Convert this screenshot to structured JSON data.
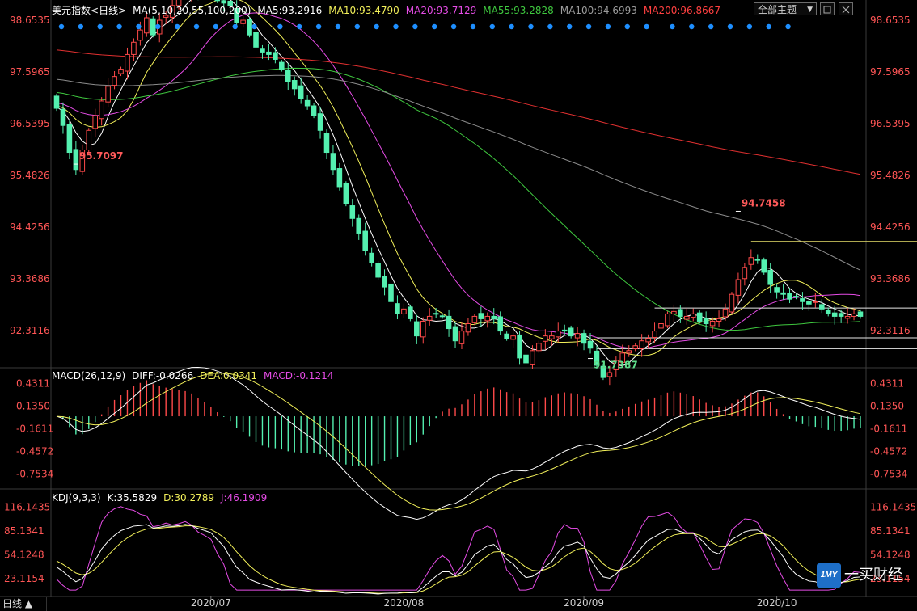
{
  "main_header": {
    "title": "美元指数",
    "period": "<日线>",
    "ma_label": "MA(5,10,20,55,100,200)",
    "ma5": "MA5:93.2916",
    "ma10": "MA10:93.4790",
    "ma20": "MA20:93.7129",
    "ma55": "MA55:93.2828",
    "ma100": "MA100:94.6993",
    "ma200": "MA200:96.8667"
  },
  "theme_button": "全部主题",
  "macd_header": {
    "label": "MACD(26,12,9)",
    "diff": "DIFF:-0.0266",
    "dea": "DEA:0.0341",
    "macd": "MACD:-0.1214"
  },
  "kdj_header": {
    "label": "KDJ(9,3,3)",
    "k": "K:35.5829",
    "d": "D:30.2789",
    "j": "J:46.1909"
  },
  "period_tab": "日线 ▲",
  "logo": {
    "badge": "1MY",
    "text": "一买财经"
  },
  "colors": {
    "up": "#ff4a4a",
    "down": "#54f0b0",
    "ma5": "#ffffff",
    "ma10": "#f2f05a",
    "ma20": "#e64ce6",
    "ma55": "#3fc83f",
    "ma100": "#8c8c8c",
    "ma200": "#e03030",
    "axis_label": "#ff5555",
    "dots": "#1e8fff"
  },
  "chart_data": [
    {
      "type": "candlestick",
      "name": "price",
      "y_ticks": [
        "98.6535",
        "97.5965",
        "96.5395",
        "95.4826",
        "94.4256",
        "93.3686",
        "92.3116"
      ],
      "ylim": [
        91.55,
        98.7
      ],
      "x_ticks": [
        "2020/07",
        "2020/08",
        "2020/09",
        "2020/10"
      ],
      "x_tick_index": [
        24,
        54,
        82,
        112
      ],
      "annotations": [
        {
          "text": "95.7097",
          "index": 3
        },
        {
          "text": "94.7458",
          "index": 106
        },
        {
          "text": "91.7387",
          "index": 83
        }
      ],
      "horizontal_lines": [
        {
          "value": 94.13,
          "from": 108,
          "to": 135
        },
        {
          "value": 92.77,
          "from": 93,
          "to": 135
        },
        {
          "value": 92.16,
          "from": 84,
          "to": 135
        },
        {
          "value": 91.94,
          "from": 84,
          "to": 135
        }
      ],
      "dots_count": 38,
      "close_start": 96.85,
      "moves": [
        -0.35,
        -0.55,
        -0.35,
        0.4,
        0.4,
        0.3,
        0.3,
        0.3,
        0.2,
        0.15,
        0.3,
        0.25,
        0.25,
        0.25,
        -0.35,
        0.3,
        0.1,
        0.2,
        0.2,
        0.1,
        0.05,
        -0.1,
        0.0,
        -0.05,
        -0.1,
        -0.05,
        -0.05,
        -0.35,
        0.05,
        -0.3,
        -0.25,
        -0.1,
        -0.05,
        -0.1,
        -0.2,
        -0.25,
        -0.15,
        -0.2,
        -0.15,
        -0.2,
        -0.3,
        -0.45,
        -0.35,
        -0.35,
        -0.35,
        -0.3,
        -0.3,
        -0.35,
        -0.25,
        -0.3,
        -0.2,
        -0.3,
        -0.25,
        0.1,
        -0.2,
        -0.35,
        0.3,
        0.1,
        0.05,
        -0.05,
        -0.25,
        -0.25,
        0.2,
        0.15,
        0.15,
        -0.05,
        0.05,
        -0.05,
        -0.25,
        -0.15,
        0.05,
        -0.45,
        -0.1,
        0.25,
        0.15,
        0.15,
        0.0,
        0.1,
        0.0,
        -0.1,
        0.05,
        -0.2,
        -0.1,
        -0.35,
        -0.25,
        0.1,
        0.25,
        0.15,
        0.05,
        0.1,
        0.1,
        0.05,
        0.15,
        0.15,
        0.2,
        0.05,
        -0.1,
        0.0,
        0.05,
        -0.15,
        -0.05,
        0.05,
        0.05,
        0.2,
        0.3,
        0.3,
        0.25,
        0.2,
        -0.05,
        -0.25,
        -0.25,
        -0.15,
        -0.05,
        -0.1,
        0.05,
        -0.1,
        -0.05,
        0.05,
        -0.15,
        -0.1,
        -0.05,
        0.0,
        0.0,
        0.05,
        -0.05
      ]
    },
    {
      "type": "bar+line",
      "name": "MACD",
      "y_ticks": [
        "0.4311",
        "0.1350",
        "-0.1611",
        "-0.4572",
        "-0.7534"
      ],
      "ylim": [
        -0.95,
        0.55
      ]
    },
    {
      "type": "line",
      "name": "KDJ",
      "y_ticks": [
        "116.1435",
        "85.1341",
        "54.1248",
        "23.1154"
      ],
      "ylim": [
        5,
        125
      ]
    }
  ]
}
